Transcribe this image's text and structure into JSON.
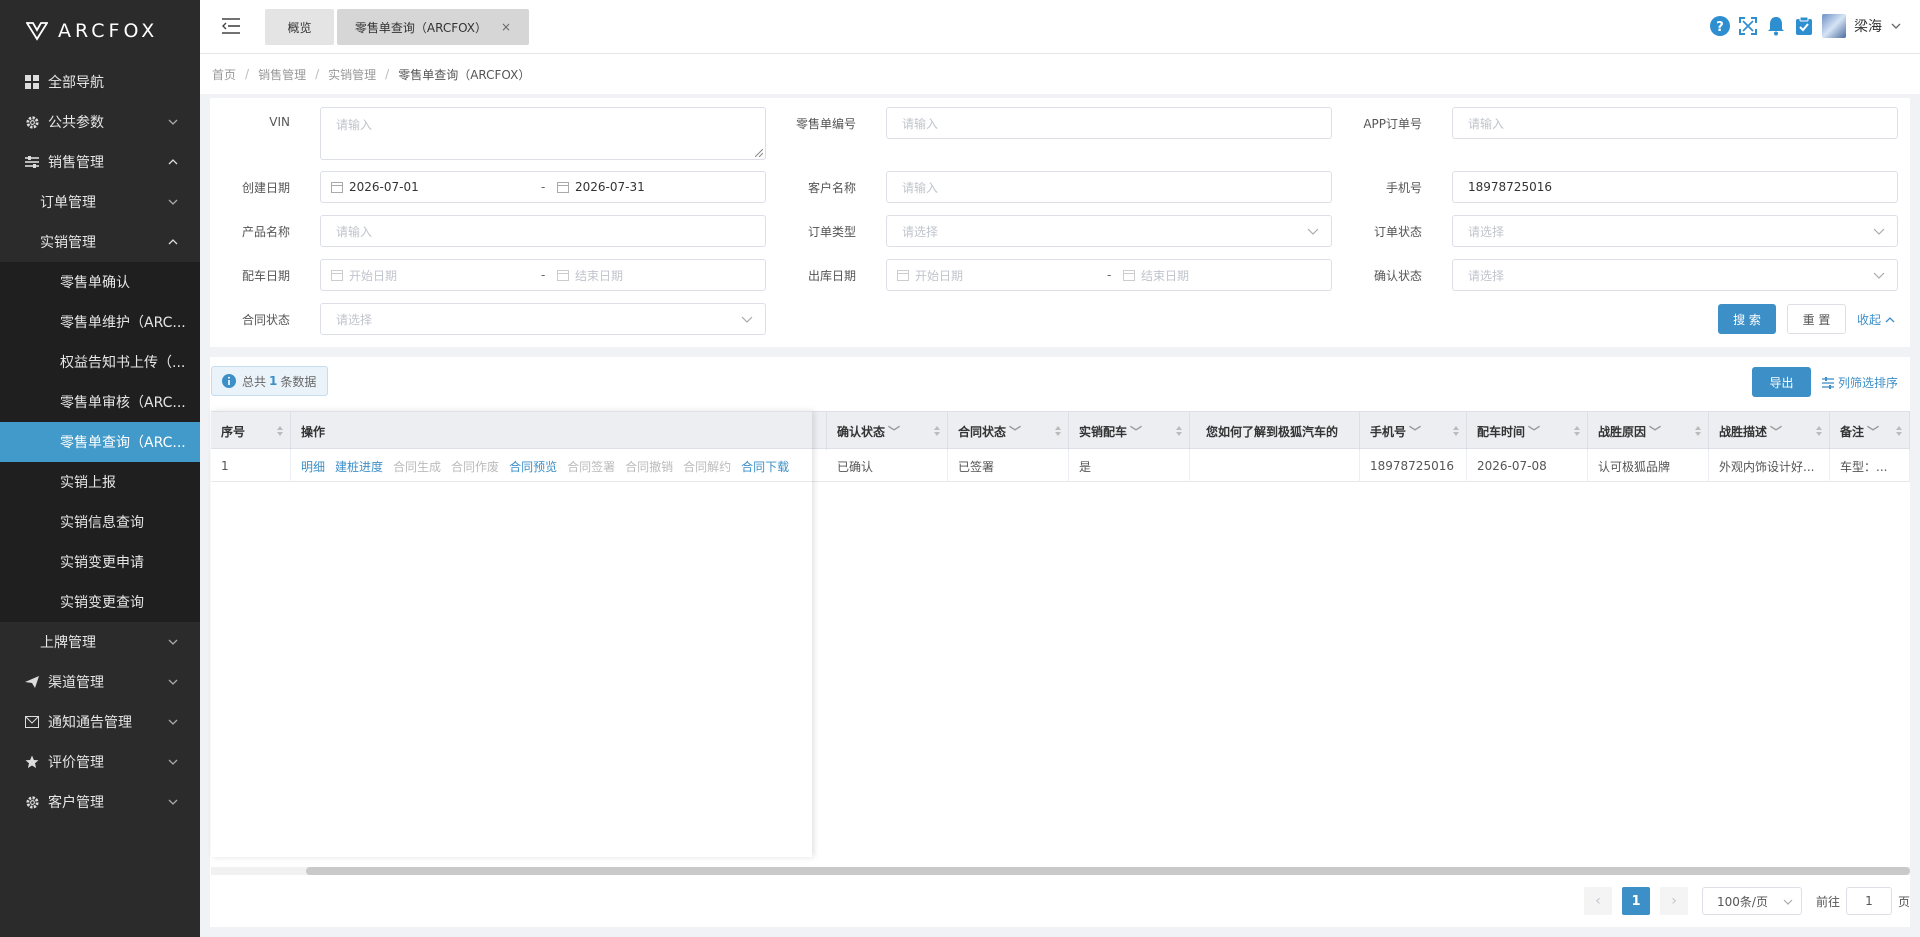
{
  "brand": {
    "name": "ARCFOX"
  },
  "sidebar": {
    "items": [
      {
        "label": "全部导航",
        "icon": "grid-icon"
      },
      {
        "label": "公共参数",
        "icon": "gear-icon"
      },
      {
        "label": "销售管理",
        "icon": "sliders-icon"
      },
      {
        "label": "订单管理"
      },
      {
        "label": "实销管理"
      },
      {
        "label": "零售单确认"
      },
      {
        "label": "零售单维护（ARC..."
      },
      {
        "label": "权益告知书上传（..."
      },
      {
        "label": "零售单审核（ARC..."
      },
      {
        "label": "零售单查询（ARC..."
      },
      {
        "label": "实销上报"
      },
      {
        "label": "实销信息查询"
      },
      {
        "label": "实销变更申请"
      },
      {
        "label": "实销变更查询"
      },
      {
        "label": "上牌管理"
      },
      {
        "label": "渠道管理",
        "icon": "send-icon"
      },
      {
        "label": "通知通告管理",
        "icon": "mail-icon"
      },
      {
        "label": "评价管理",
        "icon": "star-icon"
      },
      {
        "label": "客户管理",
        "icon": "gear-icon"
      }
    ]
  },
  "topbar": {
    "tabs": [
      {
        "label": "概览"
      },
      {
        "label": "零售单查询（ARCFOX）"
      }
    ],
    "user": "梁海"
  },
  "breadcrumb": [
    "首页",
    "销售管理",
    "实销管理",
    "零售单查询（ARCFOX）"
  ],
  "search": {
    "vin": {
      "label": "VIN",
      "placeholder": "请输入"
    },
    "retail_no": {
      "label": "零售单编号",
      "placeholder": "请输入"
    },
    "app_order": {
      "label": "APP订单号",
      "placeholder": "请输入"
    },
    "created": {
      "label": "创建日期",
      "start": "2026-07-01",
      "end": "2026-07-31"
    },
    "customer": {
      "label": "客户名称",
      "placeholder": "请输入"
    },
    "phone": {
      "label": "手机号",
      "value": "18978725016"
    },
    "product": {
      "label": "产品名称",
      "placeholder": "请输入"
    },
    "order_type": {
      "label": "订单类型",
      "placeholder": "请选择"
    },
    "order_status": {
      "label": "订单状态",
      "placeholder": "请选择"
    },
    "alloc_date": {
      "label": "配车日期",
      "start": "开始日期",
      "end": "结束日期"
    },
    "out_date": {
      "label": "出库日期",
      "start": "开始日期",
      "end": "结束日期"
    },
    "confirm_status": {
      "label": "确认状态",
      "placeholder": "请选择"
    },
    "contract_status": {
      "label": "合同状态",
      "placeholder": "请选择"
    },
    "search_btn": "搜 索",
    "reset_btn": "重 置",
    "collapse": "收起"
  },
  "table": {
    "total_prefix": "总共",
    "total_count": "1",
    "total_suffix": "条数据",
    "export_btn": "导出",
    "column_filter": "列筛选排序",
    "columns": [
      "序号",
      "操作",
      "确认状态",
      "合同状态",
      "实销配车",
      "您如何了解到极狐汽车的",
      "手机号",
      "配车时间",
      "战胜原因",
      "战胜描述",
      "备注"
    ],
    "row": {
      "index": "1",
      "ops": [
        "明细",
        "建桩进度",
        "合同生成",
        "合同作废",
        "合同预览",
        "合同签署",
        "合同撤销",
        "合同解约",
        "合同下载"
      ],
      "ops_enabled": [
        true,
        true,
        false,
        false,
        true,
        false,
        false,
        false,
        true
      ],
      "confirm_status": "已确认",
      "contract_status": "已签署",
      "alloc": "是",
      "source": "",
      "phone": "18978725016",
      "alloc_time": "2026-07-08",
      "win_reason": "认可极狐品牌",
      "win_desc": "外观内饰设计好...",
      "remark": "车型：..."
    }
  },
  "pagination": {
    "current": "1",
    "page_size": "100条/页",
    "goto_prefix": "前往",
    "goto_value": "1",
    "goto_suffix": "页"
  }
}
